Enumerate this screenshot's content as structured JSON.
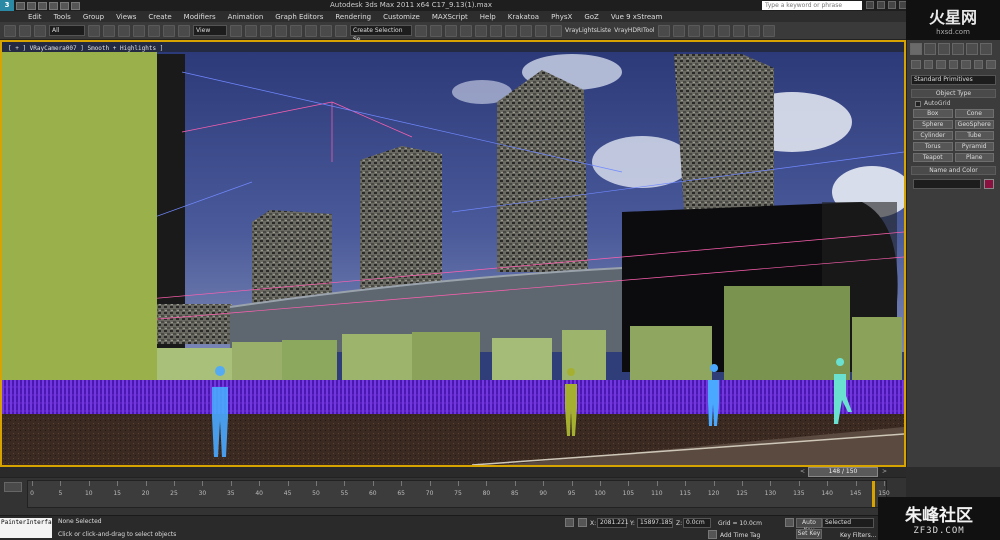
{
  "titlebar": {
    "app_logo": "3",
    "title": "Autodesk 3ds Max  2011 x64      C17_9.13(1).max",
    "search_placeholder": "Type a keyword or phrase"
  },
  "menu": [
    "Edit",
    "Tools",
    "Group",
    "Views",
    "Create",
    "Modifiers",
    "Animation",
    "Graph Editors",
    "Rendering",
    "Customize",
    "MAXScript",
    "Help",
    "Krakatoa",
    "PhysX",
    "GoZ",
    "Vue 9 xStream"
  ],
  "site_logo": {
    "main": "火星网",
    "sub": "hxsd.com"
  },
  "toolbar": {
    "filter_select": "All",
    "ref_coord_select": "View",
    "named_selection": "Create Selection Se",
    "vray_lights": "VrayLightsListe",
    "vray_hdri": "VrayHDRITool"
  },
  "viewport": {
    "label": "[ + ] VRayCamera007 ] Smooth + Highlights ]"
  },
  "command_panel": {
    "category": "Standard Primitives",
    "object_type_title": "Object Type",
    "autogrid": "AutoGrid",
    "buttons": [
      "Box",
      "Cone",
      "Sphere",
      "GeoSphere",
      "Cylinder",
      "Tube",
      "Torus",
      "Pyramid",
      "Teapot",
      "Plane"
    ],
    "name_color_title": "Name and Color",
    "swatch_color": "#8a1040"
  },
  "timeslider": {
    "frame_label": "148 / 150",
    "prev_arrow": "<",
    "next_arrow": ">"
  },
  "trackbar": {
    "ticks": [
      "0",
      "5",
      "10",
      "15",
      "20",
      "25",
      "30",
      "35",
      "40",
      "45",
      "50",
      "55",
      "60",
      "65",
      "70",
      "75",
      "80",
      "85",
      "90",
      "95",
      "100",
      "105",
      "110",
      "115",
      "120",
      "125",
      "130",
      "135",
      "140",
      "145",
      "150"
    ],
    "current_frame": 148
  },
  "statusbar": {
    "maxscript": "PainterInterfa",
    "selection": "None Selected",
    "prompt": "Click or click-and-drag to select objects",
    "x_label": "X:",
    "x_value": "2081.221",
    "y_label": "Y:",
    "y_value": "15897.185",
    "z_label": "Z:",
    "z_value": "0.0cm",
    "grid": "Grid = 10.0cm",
    "add_time_tag": "Add Time Tag",
    "auto_key": "Auto Key",
    "set_key": "Set Key",
    "selected_select": "Selected",
    "key_filters": "Key Filters..."
  },
  "watermark": {
    "main": "朱峰社区",
    "sub": "ZF3D.COM"
  }
}
